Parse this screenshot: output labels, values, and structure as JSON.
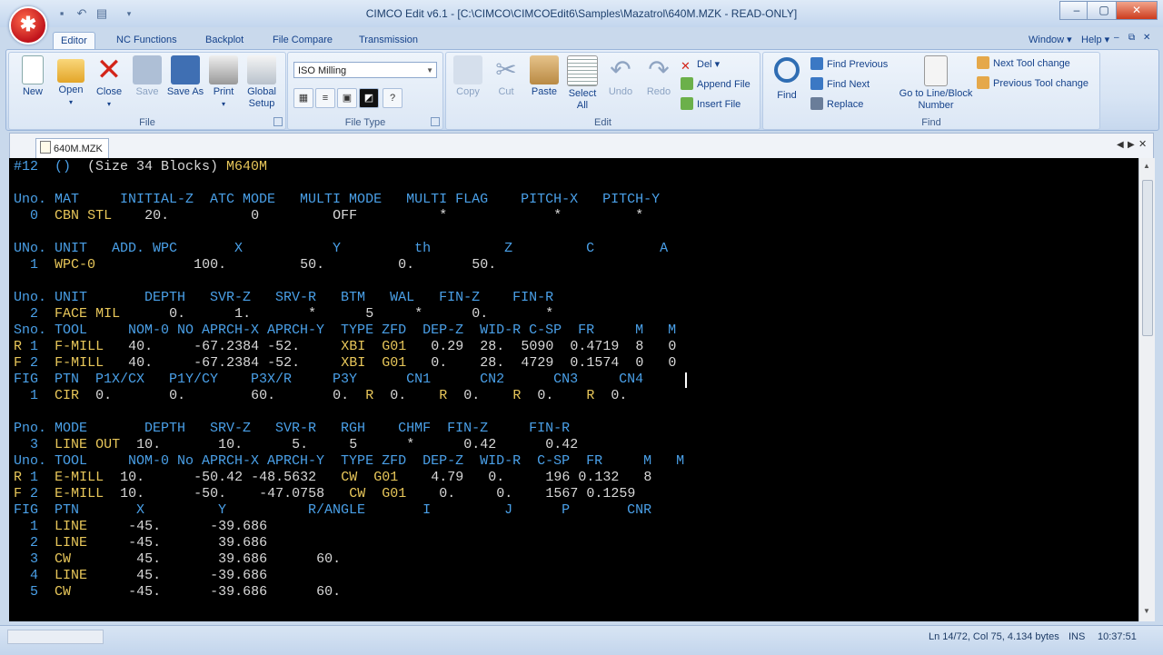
{
  "window": {
    "title": "CIMCO Edit v6.1 - [C:\\CIMCO\\CIMCOEdit6\\Samples\\Mazatrol\\640M.MZK - READ-ONLY]",
    "min": "–",
    "max": "▢",
    "close": "✕"
  },
  "ribbon": {
    "tabs": [
      "Editor",
      "NC Functions",
      "Backplot",
      "File Compare",
      "Transmission"
    ],
    "right_menu": {
      "window": "Window",
      "help": "Help"
    },
    "groups": {
      "file": {
        "label": "File",
        "buttons": [
          "New",
          "Open",
          "Close",
          "Save",
          "Save As",
          "Print",
          "Global Setup"
        ]
      },
      "filetype": {
        "label": "File Type",
        "selected": "ISO Milling"
      },
      "edit": {
        "label": "Edit",
        "buttons": [
          "Copy",
          "Cut",
          "Paste",
          "Select All",
          "Undo",
          "Redo"
        ],
        "small": [
          "Del",
          "Append File",
          "Insert File"
        ]
      },
      "find": {
        "label": "Find",
        "find_button": "Find",
        "small": [
          "Find Previous",
          "Find Next",
          "Replace"
        ],
        "goto": "Go to Line/Block Number",
        "tools": [
          "Next Tool change",
          "Previous Tool change"
        ]
      }
    }
  },
  "document": {
    "tab": "640M.MZK",
    "lines": [
      "#12  ()  (Size 34 Blocks) M640M",
      "",
      "Uno. MAT     INITIAL-Z  ATC MODE   MULTI MODE   MULTI FLAG    PITCH-X   PITCH-Y",
      "  0  CBN STL    20.          0         OFF          *             *         *",
      "",
      "UNo. UNIT   ADD. WPC       X           Y         th         Z         C        A",
      "  1  WPC-0            100.         50.         0.       50.",
      "",
      "Uno. UNIT       DEPTH   SVR-Z   SRV-R   BTM   WAL   FIN-Z    FIN-R",
      "  2  FACE MIL      0.      1.       *      5     *      0.       *",
      "Sno. TOOL     NOM-0 NO APRCH-X APRCH-Y  TYPE ZFD  DEP-Z  WID-R C-SP  FR     M   M",
      "R 1  F-MILL   40.     -67.2384 -52.     XBI  G01   0.29  28.  5090  0.4719  8   0",
      "F 2  F-MILL   40.     -67.2384 -52.     XBI  G01   0.    28.  4729  0.1574  0   0",
      "FIG  PTN  P1X/CX   P1Y/CY    P3X/R     P3Y      CN1      CN2      CN3     CN4",
      "  1  CIR  0.       0.        60.       0.  R  0.    R  0.    R  0.    R  0.",
      "",
      "Pno. MODE       DEPTH   SRV-Z   SVR-R   RGH    CHMF  FIN-Z     FIN-R",
      "  3  LINE OUT  10.       10.      5.     5      *      0.42      0.42",
      "Uno. TOOL     NOM-0 No APRCH-X APRCH-Y  TYPE ZFD  DEP-Z  WID-R  C-SP  FR     M   M",
      "R 1  E-MILL  10.      -50.42 -48.5632   CW  G01    4.79   0.     196 0.132   8",
      "F 2  E-MILL  10.      -50.    -47.0758   CW  G01    0.     0.    1567 0.1259",
      "FIG  PTN       X         Y          R/ANGLE       I         J      P       CNR",
      "  1  LINE     -45.      -39.686",
      "  2  LINE     -45.       39.686",
      "  3  CW        45.       39.686      60.",
      "  4  LINE      45.      -39.686",
      "  5  CW       -45.      -39.686      60."
    ]
  },
  "status": {
    "position": "Ln 14/72, Col 75, 4.134 bytes",
    "mode": "INS",
    "time": "10:37:51"
  }
}
